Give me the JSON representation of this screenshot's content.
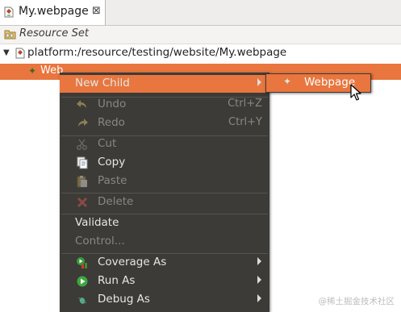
{
  "editor_tab": {
    "title": "My.webpage",
    "close_symbol": "⊠"
  },
  "resource_set": {
    "label": "Resource Set"
  },
  "tree": {
    "root": {
      "label": "platform:/resource/testing/website/My.webpage",
      "expanded": true
    },
    "child": {
      "label": "Web",
      "selected": true
    }
  },
  "context_menu": {
    "new_child": "New Child",
    "undo": {
      "label": "Undo",
      "shortcut": "Ctrl+Z",
      "enabled": false
    },
    "redo": {
      "label": "Redo",
      "shortcut": "Ctrl+Y",
      "enabled": false
    },
    "cut": {
      "label": "Cut",
      "enabled": false
    },
    "copy": {
      "label": "Copy",
      "enabled": true
    },
    "paste": {
      "label": "Paste",
      "enabled": false
    },
    "delete": {
      "label": "Delete",
      "enabled": false
    },
    "validate": "Validate",
    "control": "Control...",
    "coverage_as": "Coverage As",
    "run_as": "Run As",
    "debug_as": "Debug As"
  },
  "submenu": {
    "webpage": "Webpage"
  },
  "watermark": "@稀土掘金技术社区",
  "colors": {
    "accent": "#e8763e",
    "menu_bg": "#3c3b37",
    "menu_text": "#e6e6e6",
    "menu_disabled": "#888780"
  }
}
